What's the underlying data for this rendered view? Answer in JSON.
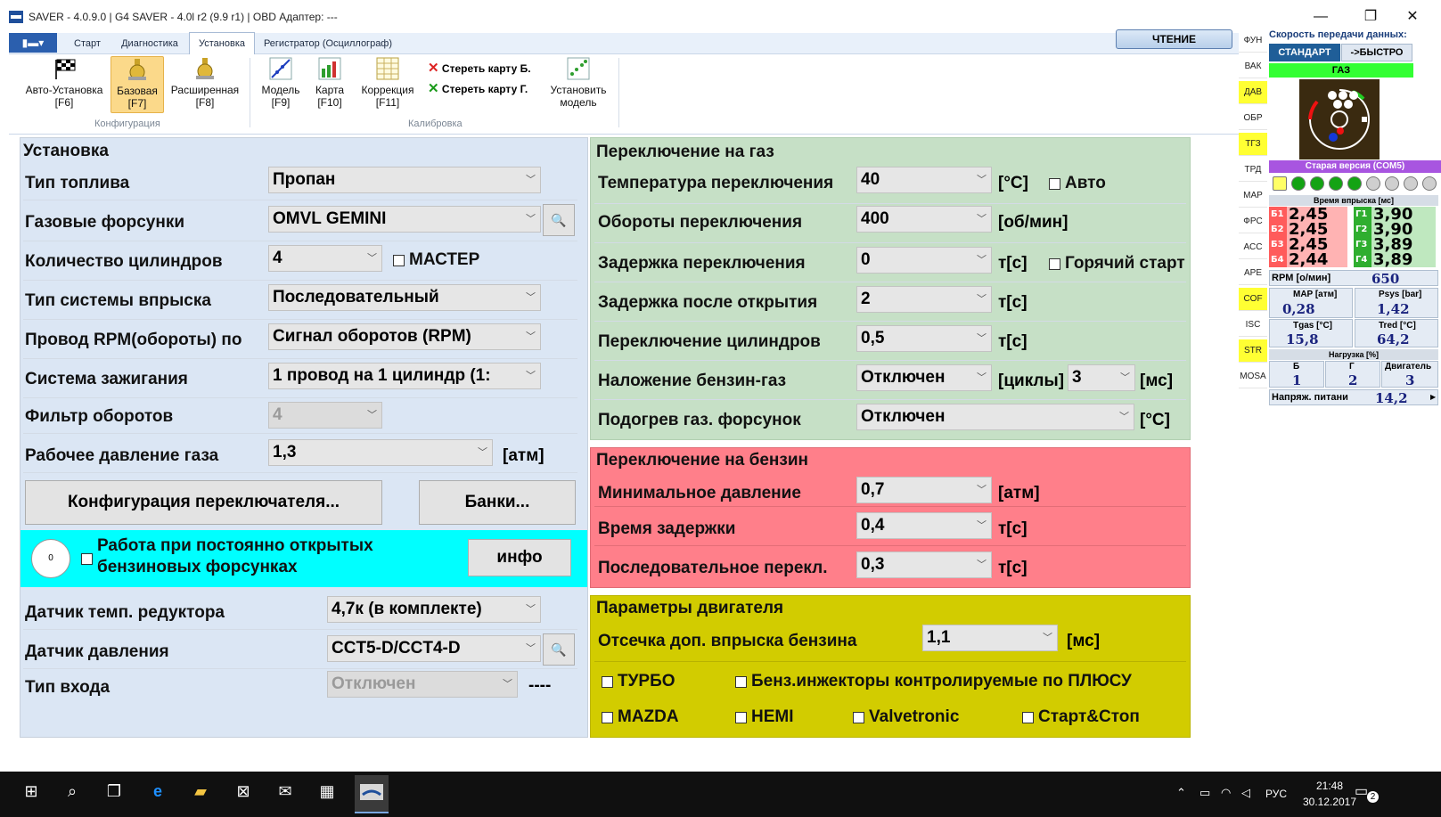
{
  "window": {
    "title": "SAVER - 4.0.9.0  |  G4 SAVER - 4.0l r2 (9.9 r1)  |  OBD Адаптер: ---",
    "minimize": "—",
    "maximize": "❐",
    "close": "✕"
  },
  "menu": {
    "file": "▮▬▾",
    "tabs": [
      "Старт",
      "Диагностика",
      "Установка",
      "Регистратор (Осциллограф)"
    ],
    "active": "Установка",
    "read_button": "ЧТЕНИЕ"
  },
  "ribbon": {
    "auto_setup": "Авто-Установка\n[F6]",
    "basic": "Базовая\n[F7]",
    "extended": "Расширенная\n[F8]",
    "group_config": "Конфигурация",
    "model": "Модель\n[F9]",
    "map": "Карта\n[F10]",
    "correction": "Коррекция\n[F11]",
    "erase_b": "Стереть карту Б.",
    "erase_g": "Стереть карту Г.",
    "set_model": "Установить\nмодель",
    "group_calib": "Калибровка"
  },
  "setup": {
    "title": "Установка",
    "fuel_type": {
      "label": "Тип топлива",
      "value": "Пропан"
    },
    "gas_injectors": {
      "label": "Газовые форсунки",
      "value": "OMVL GEMINI"
    },
    "cylinders": {
      "label": "Количество цилиндров",
      "value": "4",
      "master": "МАСТЕР"
    },
    "injection_type": {
      "label": "Тип системы впрыска",
      "value": "Последовательный"
    },
    "rpm_wire": {
      "label": "Провод RPM(обороты) по",
      "value": "Сигнал оборотов (RPM)"
    },
    "ignition": {
      "label": "Система зажигания",
      "value": "1 провод на 1 цилиндр (1:"
    },
    "rpm_filter": {
      "label": "Фильтр оборотов",
      "value": "4"
    },
    "gas_pressure": {
      "label": "Рабочее давление газа",
      "value": "1,3",
      "unit": "[атм]"
    },
    "config_switch": "Конфигурация переключателя...",
    "banks": "Банки...",
    "open_injectors_indicator": "0",
    "open_injectors": "Работа при постоянно открытых\nбензиновых форсунках",
    "info": "инфо",
    "reducer_temp": {
      "label": "Датчик темп. редуктора",
      "value": "4,7к (в комплекте)"
    },
    "pressure_sensor": {
      "label": "Датчик давления",
      "value": "CCT5-D/CCT4-D"
    },
    "input_type": {
      "label": "Тип входа",
      "value": "Отключен",
      "extra": "----"
    }
  },
  "switch_gas": {
    "title": "Переключение на газ",
    "temp": {
      "label": "Температура переключения",
      "value": "40",
      "unit": "[°C]",
      "auto": "Авто"
    },
    "rpm": {
      "label": "Обороты переключения",
      "value": "400",
      "unit": "[об/мин]"
    },
    "delay": {
      "label": "Задержка переключения",
      "value": "0",
      "unit": "т[с]",
      "hot": "Горячий старт"
    },
    "delay_open": {
      "label": "Задержка после открытия",
      "value": "2",
      "unit": "т[с]"
    },
    "cyl_switch": {
      "label": "Переключение цилиндров",
      "value": "0,5",
      "unit": "т[с]"
    },
    "overlap": {
      "label": "Наложение бензин-газ",
      "value": "Отключен",
      "unit": "[циклы]",
      "value2": "3",
      "unit2": "[мс]"
    },
    "heating": {
      "label": "Подогрев газ. форсунок",
      "value": "Отключен",
      "unit": "[°C]"
    }
  },
  "switch_petrol": {
    "title": "Переключение на бензин",
    "min_pressure": {
      "label": "Минимальное давление",
      "value": "0,7",
      "unit": "[атм]"
    },
    "delay_time": {
      "label": "Время задержки",
      "value": "0,4",
      "unit": "т[с]"
    },
    "seq_switch": {
      "label": "Последовательное перекл.",
      "value": "0,3",
      "unit": "т[с]"
    }
  },
  "engine": {
    "title": "Параметры двигателя",
    "cutoff": {
      "label": "Отсечка доп. впрыска бензина",
      "value": "1,1",
      "unit": "[мс]"
    },
    "turbo": "ТУРБО",
    "plus_inj": "Бенз.инжекторы контролируемые по ПЛЮСУ",
    "mazda": "MAZDA",
    "hemi": "HEMI",
    "valvetronic": "Valvetronic",
    "start_stop": "Старт&Стоп"
  },
  "side_tabs": [
    "ФУН",
    "ВАК",
    "ДАВ",
    "ОБР",
    "ТГЗ",
    "ТРД",
    "МАР",
    "ФРС",
    "АСС",
    "АРЕ",
    "COF",
    "ISC",
    "STR",
    "MOSA"
  ],
  "side_tabs_yellow": [
    "ДАВ",
    "ТГЗ",
    "COF",
    "STR"
  ],
  "status": {
    "speed_title": "Скорость передачи данных:",
    "standard": "СТАНДАРТ",
    "fast": "->БЫСТРО",
    "gas": "ГАЗ",
    "old_version": "Старая версия (COM5)",
    "inj_time_title": "Время впрыска [мс]",
    "inj": [
      {
        "b": "Б1",
        "bv": "2,45",
        "g": "Г1",
        "gv": "3,90"
      },
      {
        "b": "Б2",
        "bv": "2,45",
        "g": "Г2",
        "gv": "3,90"
      },
      {
        "b": "Б3",
        "bv": "2,45",
        "g": "Г3",
        "gv": "3,89"
      },
      {
        "b": "Б4",
        "bv": "2,44",
        "g": "Г4",
        "gv": "3,89"
      }
    ],
    "rpm_label": "RPM [о/мин]",
    "rpm": "650",
    "map_label": "MAP [атм]",
    "map": "0,28",
    "psys_label": "Psys [bar]",
    "psys": "1,42",
    "tgas_label": "Tgas [°C]",
    "tgas": "15,8",
    "tred_label": "Tred [°C]",
    "tred": "64,2",
    "load_title": "Нагрузка [%]",
    "load_b_label": "Б",
    "load_b": "1",
    "load_g_label": "Г",
    "load_g": "2",
    "load_e_label": "Двигатель",
    "load_e": "3",
    "voltage_label": "Напряж. питани",
    "voltage": "14,2"
  },
  "taskbar": {
    "lang": "РУС",
    "time": "21:48",
    "date": "30.12.2017",
    "notif": "2"
  },
  "colors": {
    "green_panel": "#c6e0c6",
    "red_panel": "#ff7f8a",
    "yellow_panel": "#d2cc00",
    "cyan": "#00ffff",
    "left_panel": "#dbe6f4"
  }
}
